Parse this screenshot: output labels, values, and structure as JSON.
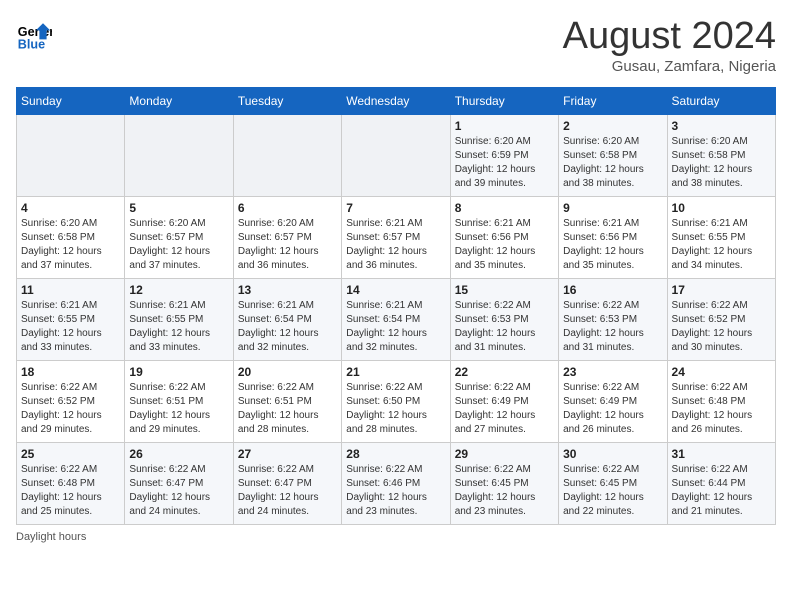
{
  "header": {
    "logo_line1": "General",
    "logo_line2": "Blue",
    "month": "August 2024",
    "location": "Gusau, Zamfara, Nigeria"
  },
  "days_of_week": [
    "Sunday",
    "Monday",
    "Tuesday",
    "Wednesday",
    "Thursday",
    "Friday",
    "Saturday"
  ],
  "weeks": [
    [
      {
        "num": "",
        "info": ""
      },
      {
        "num": "",
        "info": ""
      },
      {
        "num": "",
        "info": ""
      },
      {
        "num": "",
        "info": ""
      },
      {
        "num": "1",
        "info": "Sunrise: 6:20 AM\nSunset: 6:59 PM\nDaylight: 12 hours and 39 minutes."
      },
      {
        "num": "2",
        "info": "Sunrise: 6:20 AM\nSunset: 6:58 PM\nDaylight: 12 hours and 38 minutes."
      },
      {
        "num": "3",
        "info": "Sunrise: 6:20 AM\nSunset: 6:58 PM\nDaylight: 12 hours and 38 minutes."
      }
    ],
    [
      {
        "num": "4",
        "info": "Sunrise: 6:20 AM\nSunset: 6:58 PM\nDaylight: 12 hours and 37 minutes."
      },
      {
        "num": "5",
        "info": "Sunrise: 6:20 AM\nSunset: 6:57 PM\nDaylight: 12 hours and 37 minutes."
      },
      {
        "num": "6",
        "info": "Sunrise: 6:20 AM\nSunset: 6:57 PM\nDaylight: 12 hours and 36 minutes."
      },
      {
        "num": "7",
        "info": "Sunrise: 6:21 AM\nSunset: 6:57 PM\nDaylight: 12 hours and 36 minutes."
      },
      {
        "num": "8",
        "info": "Sunrise: 6:21 AM\nSunset: 6:56 PM\nDaylight: 12 hours and 35 minutes."
      },
      {
        "num": "9",
        "info": "Sunrise: 6:21 AM\nSunset: 6:56 PM\nDaylight: 12 hours and 35 minutes."
      },
      {
        "num": "10",
        "info": "Sunrise: 6:21 AM\nSunset: 6:55 PM\nDaylight: 12 hours and 34 minutes."
      }
    ],
    [
      {
        "num": "11",
        "info": "Sunrise: 6:21 AM\nSunset: 6:55 PM\nDaylight: 12 hours and 33 minutes."
      },
      {
        "num": "12",
        "info": "Sunrise: 6:21 AM\nSunset: 6:55 PM\nDaylight: 12 hours and 33 minutes."
      },
      {
        "num": "13",
        "info": "Sunrise: 6:21 AM\nSunset: 6:54 PM\nDaylight: 12 hours and 32 minutes."
      },
      {
        "num": "14",
        "info": "Sunrise: 6:21 AM\nSunset: 6:54 PM\nDaylight: 12 hours and 32 minutes."
      },
      {
        "num": "15",
        "info": "Sunrise: 6:22 AM\nSunset: 6:53 PM\nDaylight: 12 hours and 31 minutes."
      },
      {
        "num": "16",
        "info": "Sunrise: 6:22 AM\nSunset: 6:53 PM\nDaylight: 12 hours and 31 minutes."
      },
      {
        "num": "17",
        "info": "Sunrise: 6:22 AM\nSunset: 6:52 PM\nDaylight: 12 hours and 30 minutes."
      }
    ],
    [
      {
        "num": "18",
        "info": "Sunrise: 6:22 AM\nSunset: 6:52 PM\nDaylight: 12 hours and 29 minutes."
      },
      {
        "num": "19",
        "info": "Sunrise: 6:22 AM\nSunset: 6:51 PM\nDaylight: 12 hours and 29 minutes."
      },
      {
        "num": "20",
        "info": "Sunrise: 6:22 AM\nSunset: 6:51 PM\nDaylight: 12 hours and 28 minutes."
      },
      {
        "num": "21",
        "info": "Sunrise: 6:22 AM\nSunset: 6:50 PM\nDaylight: 12 hours and 28 minutes."
      },
      {
        "num": "22",
        "info": "Sunrise: 6:22 AM\nSunset: 6:49 PM\nDaylight: 12 hours and 27 minutes."
      },
      {
        "num": "23",
        "info": "Sunrise: 6:22 AM\nSunset: 6:49 PM\nDaylight: 12 hours and 26 minutes."
      },
      {
        "num": "24",
        "info": "Sunrise: 6:22 AM\nSunset: 6:48 PM\nDaylight: 12 hours and 26 minutes."
      }
    ],
    [
      {
        "num": "25",
        "info": "Sunrise: 6:22 AM\nSunset: 6:48 PM\nDaylight: 12 hours and 25 minutes."
      },
      {
        "num": "26",
        "info": "Sunrise: 6:22 AM\nSunset: 6:47 PM\nDaylight: 12 hours and 24 minutes."
      },
      {
        "num": "27",
        "info": "Sunrise: 6:22 AM\nSunset: 6:47 PM\nDaylight: 12 hours and 24 minutes."
      },
      {
        "num": "28",
        "info": "Sunrise: 6:22 AM\nSunset: 6:46 PM\nDaylight: 12 hours and 23 minutes."
      },
      {
        "num": "29",
        "info": "Sunrise: 6:22 AM\nSunset: 6:45 PM\nDaylight: 12 hours and 23 minutes."
      },
      {
        "num": "30",
        "info": "Sunrise: 6:22 AM\nSunset: 6:45 PM\nDaylight: 12 hours and 22 minutes."
      },
      {
        "num": "31",
        "info": "Sunrise: 6:22 AM\nSunset: 6:44 PM\nDaylight: 12 hours and 21 minutes."
      }
    ]
  ],
  "footer": {
    "label": "Daylight hours"
  }
}
